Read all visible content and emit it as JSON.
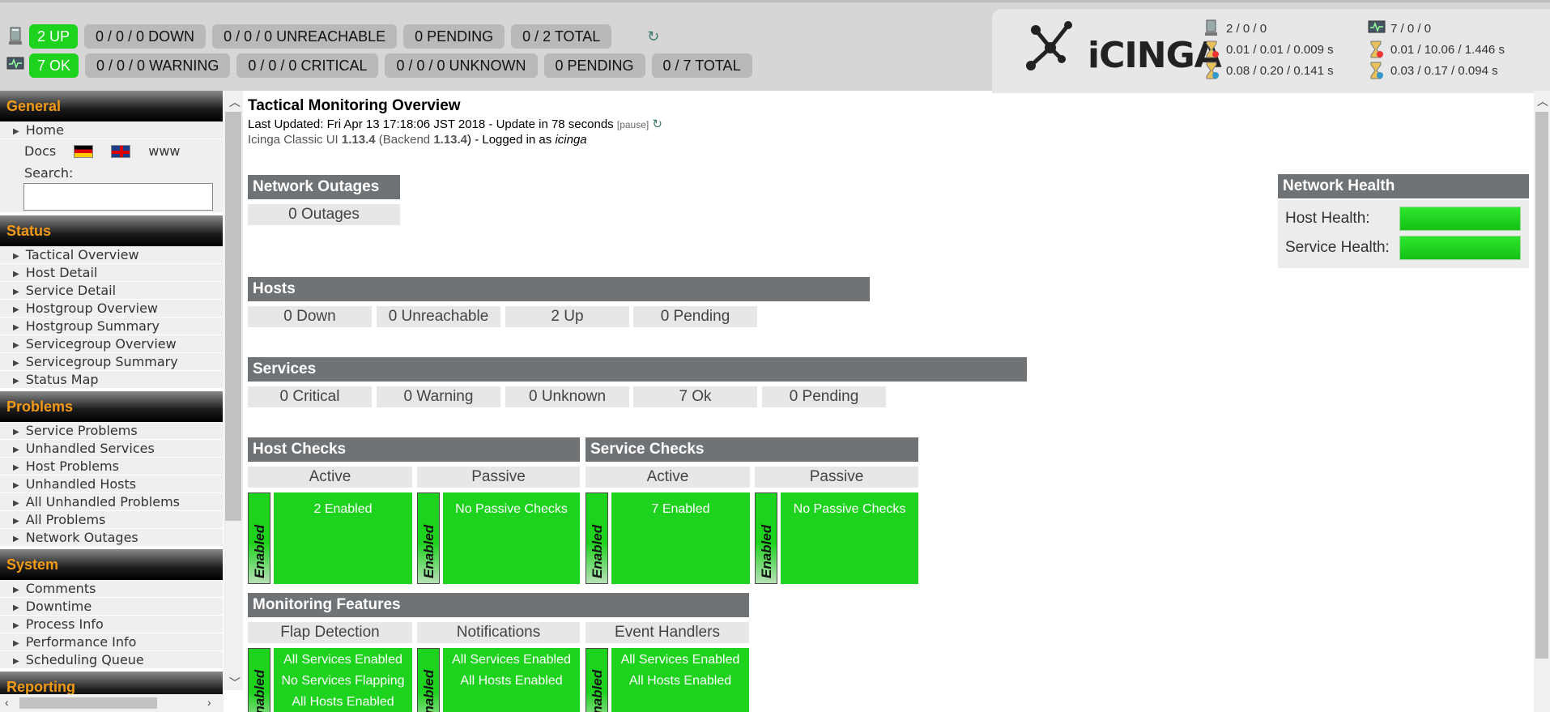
{
  "topbar": {
    "hosts": {
      "up": "2 UP",
      "down": "0 / 0 / 0 DOWN",
      "unreachable": "0 / 0 / 0 UNREACHABLE",
      "pending": "0 PENDING",
      "total": "0 / 2 TOTAL"
    },
    "services": {
      "ok": "7 OK",
      "warning": "0 / 0 / 0 WARNING",
      "critical": "0 / 0 / 0 CRITICAL",
      "unknown": "0 / 0 / 0 UNKNOWN",
      "pending": "0 PENDING",
      "total": "0 / 7 TOTAL"
    },
    "reload_icon": "reload-icon"
  },
  "logo": {
    "text": "iCINGA"
  },
  "perf": {
    "host_counts": "2 / 0 / 0",
    "host_latency": "0.01 / 0.01 / 0.009 s",
    "host_exec": "0.08 / 0.20 / 0.141 s",
    "svc_counts": "7 / 0 / 0",
    "svc_latency": "0.01 / 10.06 / 1.446 s",
    "svc_exec": "0.03 / 0.17 / 0.094 s"
  },
  "sidebar": {
    "general": {
      "title": "General",
      "home": "Home",
      "docs": "Docs",
      "www": "www",
      "search_label": "Search:"
    },
    "status": {
      "title": "Status",
      "items": [
        "Tactical Overview",
        "Host Detail",
        "Service Detail",
        "Hostgroup Overview",
        "Hostgroup Summary",
        "Servicegroup Overview",
        "Servicegroup Summary",
        "Status Map"
      ]
    },
    "problems": {
      "title": "Problems",
      "items": [
        "Service Problems",
        "Unhandled Services",
        "Host Problems",
        "Unhandled Hosts",
        "All Unhandled Problems",
        "All Problems",
        "Network Outages"
      ]
    },
    "system": {
      "title": "System",
      "items": [
        "Comments",
        "Downtime",
        "Process Info",
        "Performance Info",
        "Scheduling Queue"
      ]
    },
    "reporting": {
      "title": "Reporting"
    }
  },
  "main": {
    "title": "Tactical Monitoring Overview",
    "last_updated_prefix": "Last Updated: Fri Apr 13 17:18:06 JST 2018 - Update in 78 seconds",
    "pause": "[pause]",
    "version": {
      "ui": "Icinga Classic UI",
      "ui_ver": "1.13.4",
      "backend": "(Backend",
      "backend_ver": "1.13.4",
      "logged": ") - Logged in as",
      "user": "icinga"
    },
    "outages": {
      "title": "Network Outages",
      "value": "0 Outages"
    },
    "health": {
      "title": "Network Health",
      "host_label": "Host Health:",
      "service_label": "Service Health:",
      "host_level": 1.0,
      "service_level": 1.0
    },
    "hosts": {
      "title": "Hosts",
      "cells": [
        "0 Down",
        "0 Unreachable",
        "2 Up",
        "0 Pending"
      ]
    },
    "services": {
      "title": "Services",
      "cells": [
        "0 Critical",
        "0 Warning",
        "0 Unknown",
        "7 Ok",
        "0 Pending"
      ]
    },
    "host_checks": {
      "title": "Host Checks",
      "active": "Active",
      "passive": "Passive",
      "active_value": "2 Enabled",
      "passive_value": "No Passive Checks"
    },
    "service_checks": {
      "title": "Service Checks",
      "active": "Active",
      "passive": "Passive",
      "active_value": "7 Enabled",
      "passive_value": "No Passive Checks"
    },
    "features": {
      "title": "Monitoring Features",
      "flap": {
        "label": "Flap Detection",
        "lines": [
          "All Services Enabled",
          "No Services Flapping",
          "All Hosts Enabled"
        ]
      },
      "notifications": {
        "label": "Notifications",
        "lines": [
          "All Services Enabled",
          "All Hosts Enabled"
        ]
      },
      "events": {
        "label": "Event Handlers",
        "lines": [
          "All Services Enabled",
          "All Hosts Enabled"
        ]
      }
    },
    "enabled_label": "Enabled"
  }
}
